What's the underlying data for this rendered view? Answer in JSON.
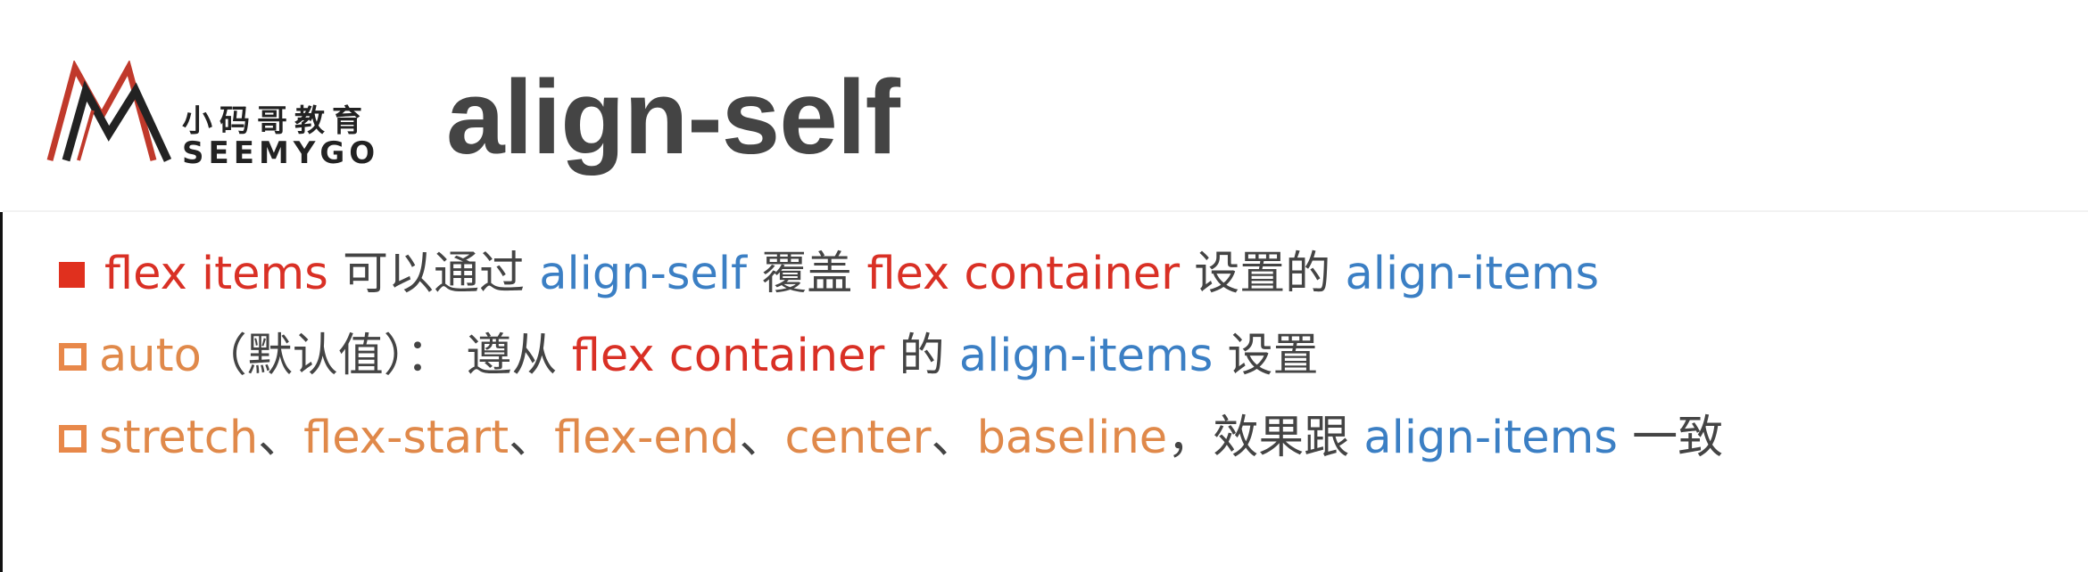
{
  "header": {
    "logo": {
      "cn_text": "小码哥教育",
      "en_text": "SEEMYGO"
    },
    "title": "align-self"
  },
  "lines": [
    {
      "bullet": "filled",
      "segments": [
        {
          "text": "flex items",
          "color": "red"
        },
        {
          "text": " 可以通过 ",
          "color": "gray"
        },
        {
          "text": "align-self",
          "color": "blue"
        },
        {
          "text": " 覆盖 ",
          "color": "gray"
        },
        {
          "text": "flex container",
          "color": "red"
        },
        {
          "text": " 设置的 ",
          "color": "gray"
        },
        {
          "text": "align-items",
          "color": "blue"
        }
      ]
    },
    {
      "bullet": "hollow",
      "segments": [
        {
          "text": "auto",
          "color": "orange"
        },
        {
          "text": "（默认值）： 遵从 ",
          "color": "gray"
        },
        {
          "text": "flex container",
          "color": "red"
        },
        {
          "text": " 的 ",
          "color": "gray"
        },
        {
          "text": "align-items",
          "color": "blue"
        },
        {
          "text": " 设置",
          "color": "gray"
        }
      ]
    },
    {
      "bullet": "hollow",
      "segments": [
        {
          "text": "stretch",
          "color": "orange"
        },
        {
          "text": "、",
          "color": "gray"
        },
        {
          "text": "flex-start",
          "color": "orange"
        },
        {
          "text": "、",
          "color": "gray"
        },
        {
          "text": "flex-end",
          "color": "orange"
        },
        {
          "text": "、",
          "color": "gray"
        },
        {
          "text": "center",
          "color": "orange"
        },
        {
          "text": "、",
          "color": "gray"
        },
        {
          "text": "baseline",
          "color": "orange"
        },
        {
          "text": "，效果跟 ",
          "color": "gray"
        },
        {
          "text": "align-items",
          "color": "blue"
        },
        {
          "text": " 一致",
          "color": "gray"
        }
      ]
    }
  ],
  "colors": {
    "red": "#d93025",
    "blue": "#3b7fc4",
    "orange": "#e0894a",
    "gray": "#444444",
    "bullet_filled": "#e0301e",
    "bullet_hollow": "#e8884a",
    "logo_red": "#c0392b",
    "logo_dark": "#222222"
  }
}
